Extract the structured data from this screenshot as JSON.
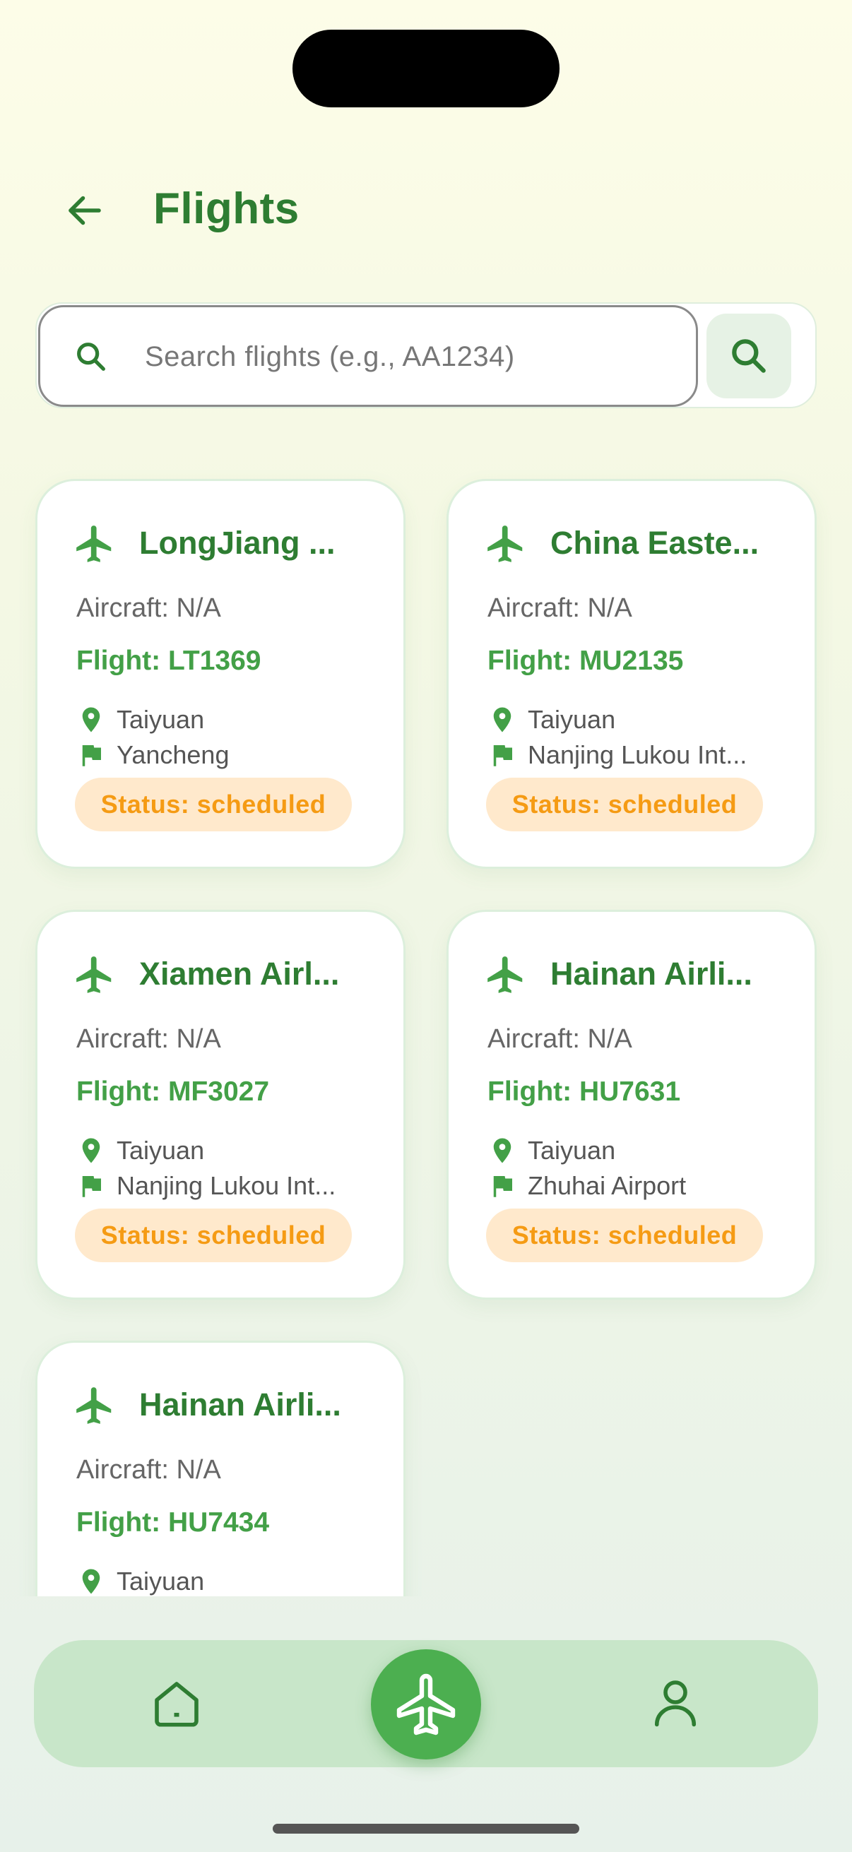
{
  "header": {
    "title": "Flights",
    "back_icon": "arrow-left-icon"
  },
  "search": {
    "placeholder": "Search flights (e.g., AA1234)",
    "value": "",
    "field_icon": "search-icon",
    "button_icon": "search-icon"
  },
  "flights": [
    {
      "airline": "LongJiang ...",
      "aircraft": "Aircraft: N/A",
      "flight": "Flight: LT1369",
      "origin": "Taiyuan",
      "destination": "Yancheng",
      "status": "Status: scheduled"
    },
    {
      "airline": "China Easte...",
      "aircraft": "Aircraft: N/A",
      "flight": "Flight: MU2135",
      "origin": "Taiyuan",
      "destination": "Nanjing Lukou Int...",
      "status": "Status: scheduled"
    },
    {
      "airline": "Xiamen Airl...",
      "aircraft": "Aircraft: N/A",
      "flight": "Flight: MF3027",
      "origin": "Taiyuan",
      "destination": "Nanjing Lukou Int...",
      "status": "Status: scheduled"
    },
    {
      "airline": "Hainan Airli...",
      "aircraft": "Aircraft: N/A",
      "flight": "Flight: HU7631",
      "origin": "Taiyuan",
      "destination": "Zhuhai Airport",
      "status": "Status: scheduled"
    },
    {
      "airline": "Hainan Airli...",
      "aircraft": "Aircraft: N/A",
      "flight": "Flight: HU7434",
      "origin": "Taiyuan",
      "destination": "",
      "status": ""
    }
  ],
  "icons": {
    "card_plane": "airplane-icon",
    "origin": "location-pin-icon",
    "destination": "flag-icon"
  },
  "nav": {
    "items": [
      {
        "icon": "home-icon",
        "active": false
      },
      {
        "icon": "airplane-icon",
        "active": true
      },
      {
        "icon": "person-icon",
        "active": false
      }
    ]
  },
  "colors": {
    "primary": "#2e7d32",
    "accent": "#4caf50",
    "flight_number": "#43a047",
    "status_bg": "#ffe9cc",
    "status_text": "#f59b14",
    "nav_bg": "#c8e6c9"
  }
}
